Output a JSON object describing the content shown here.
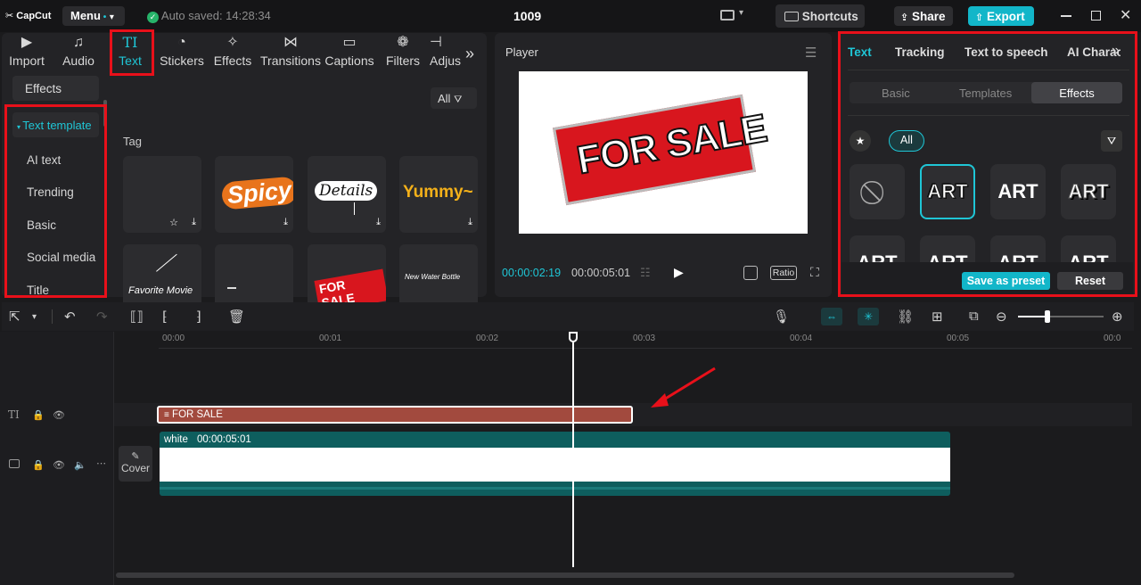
{
  "app": {
    "logo": "CapCut",
    "menu_label": "Menu",
    "auto_saved": "Auto saved: 14:28:34",
    "project_title": "1009",
    "shortcuts_label": "Shortcuts",
    "share_label": "Share",
    "export_label": "Export"
  },
  "media_tabs": [
    {
      "label": "Import",
      "icon": "import-icon"
    },
    {
      "label": "Audio",
      "icon": "audio-icon"
    },
    {
      "label": "Text",
      "icon": "text-icon"
    },
    {
      "label": "Stickers",
      "icon": "stickers-icon"
    },
    {
      "label": "Effects",
      "icon": "effects-icon"
    },
    {
      "label": "Transitions",
      "icon": "transitions-icon"
    },
    {
      "label": "Captions",
      "icon": "captions-icon"
    },
    {
      "label": "Filters",
      "icon": "filters-icon"
    },
    {
      "label": "Adjus",
      "icon": "adjust-icon"
    }
  ],
  "left_nav": {
    "effects_btn": "Effects",
    "items": [
      "Text template",
      "AI text",
      "Trending",
      "Basic",
      "Social media",
      "Title"
    ]
  },
  "templates": {
    "filter_label": "All",
    "tag_label": "Tag",
    "cards": [
      "",
      "Spicy",
      "Details",
      "Yummy~",
      "Favorite Movie",
      "",
      "FOR SALE",
      "New Water Bottle"
    ]
  },
  "player": {
    "title": "Player",
    "current_time": "00:00:02:19",
    "total_time": "00:00:05:01",
    "ratio_label": "Ratio",
    "preview_text": "FOR SALE"
  },
  "right_panel": {
    "tabs": [
      "Text",
      "Tracking",
      "Text to speech",
      "AI Characters"
    ],
    "subtabs": [
      "Basic",
      "Templates",
      "Effects"
    ],
    "filter_all": "All",
    "art_label": "ART",
    "save_preset": "Save as preset",
    "reset": "Reset"
  },
  "timeline": {
    "ticks": [
      "00:00",
      "00:01",
      "00:02",
      "00:03",
      "00:04",
      "00:05",
      "00:0"
    ],
    "text_clip": "FOR SALE",
    "video_clip_name": "white",
    "video_clip_duration": "00:00:05:01",
    "cover_label": "Cover"
  },
  "colors": {
    "accent": "#1fc6d6",
    "export_bg": "#12b6c9",
    "highlight_red": "#e8101a",
    "text_clip": "#a24a3e",
    "video_clip": "#0e5e5e"
  }
}
